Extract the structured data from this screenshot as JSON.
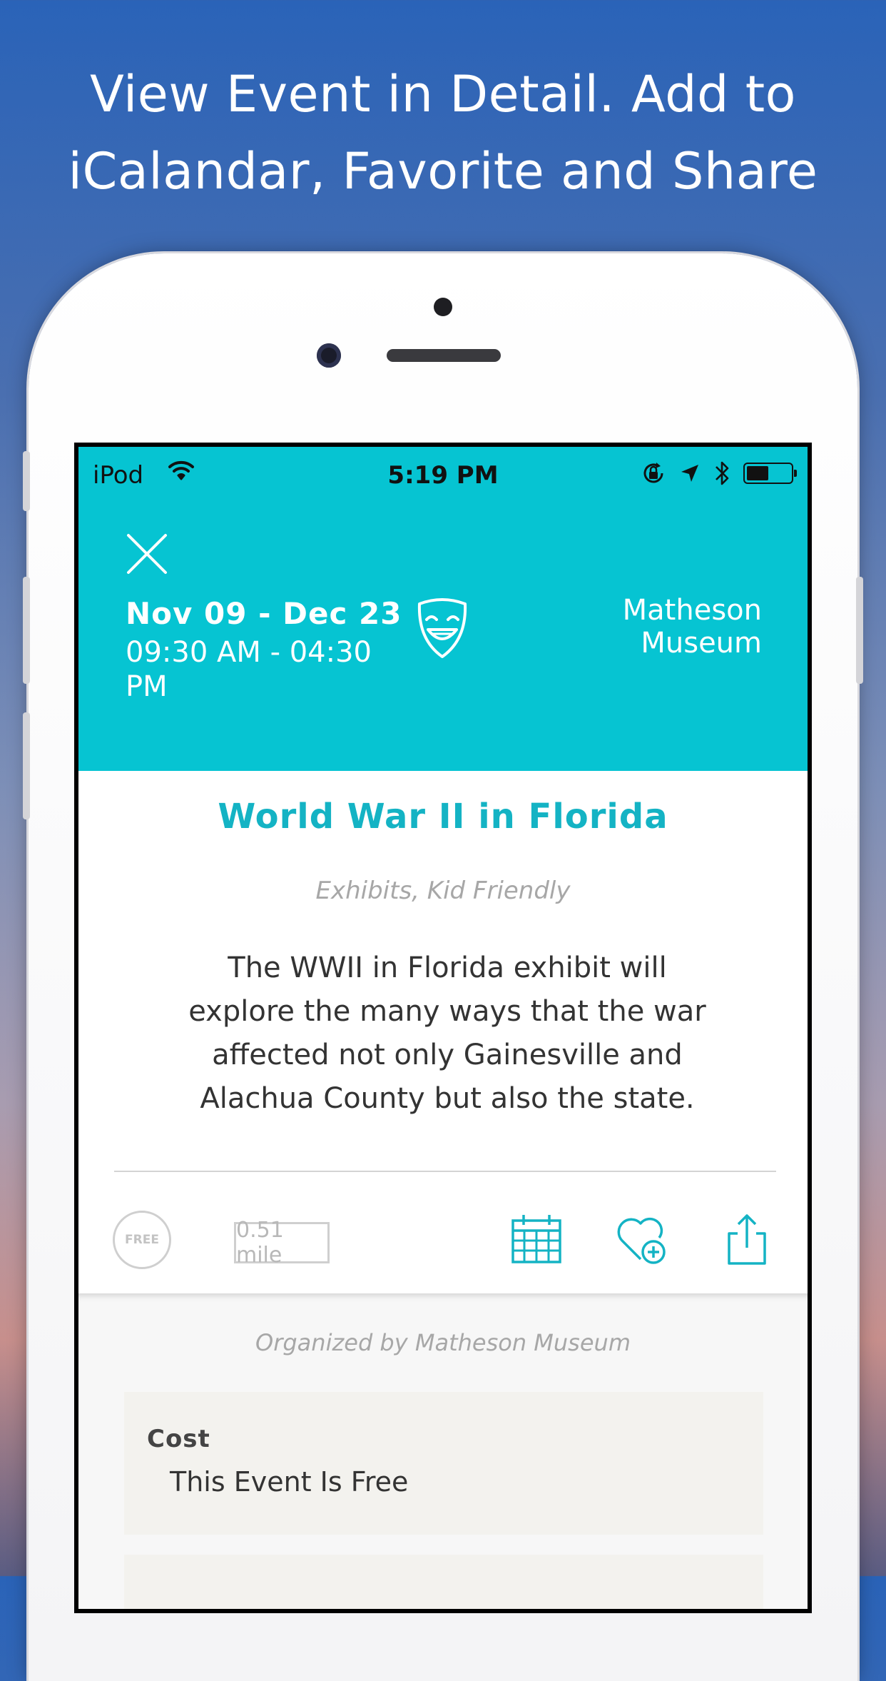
{
  "promo": {
    "headline_line1": "View Event in Detail. Add to",
    "headline_line2": "iCalandar, Favorite and Share"
  },
  "status_bar": {
    "carrier": "iPod",
    "time": "5:19 PM",
    "battery_level": 0.5
  },
  "event": {
    "date_range": "Nov 09 - Dec 23",
    "time_range": "09:30 AM - 04:30 PM",
    "venue": "Matheson Museum",
    "title": "World War II in Florida",
    "categories": "Exhibits, Kid Friendly",
    "description": "The WWII in Florida exhibit will explore the many ways that the war affected not only Gainesville and Alachua County but also the state.",
    "price_badge": "FREE",
    "distance": "0.51 mile",
    "organizer": "Organized by Matheson Museum"
  },
  "cost": {
    "label": "Cost",
    "value": "This Event Is Free"
  },
  "icons": {
    "close": "close-icon",
    "category": "comedy-mask-icon",
    "calendar": "calendar-icon",
    "favorite": "heart-plus-icon",
    "share": "share-icon"
  },
  "colors": {
    "accent": "#06c4d2",
    "title": "#14b3c4",
    "card_bg": "#f3f2ee"
  }
}
